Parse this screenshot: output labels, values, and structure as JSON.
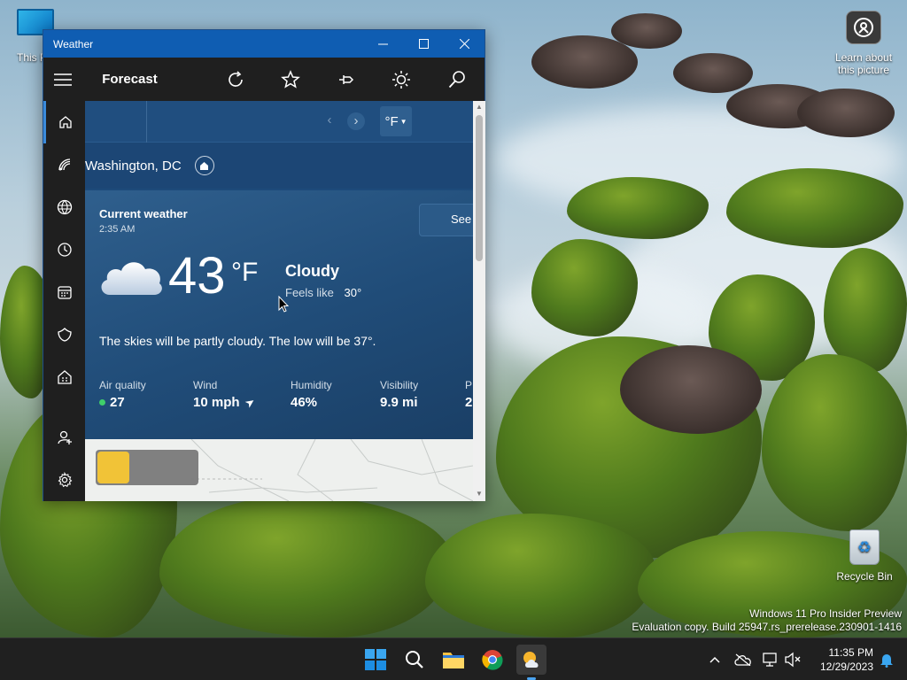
{
  "desktop": {
    "this_pc_label": "This PC",
    "learn_label": "Learn about this picture",
    "recycle_label": "Recycle Bin",
    "watermark_line1": "Windows 11 Pro Insider Preview",
    "watermark_line2": "Evaluation copy. Build 25947.rs_prerelease.230901-1416"
  },
  "window": {
    "title": "Weather",
    "app_title": "Forecast"
  },
  "weather": {
    "unit": "°F",
    "location": "Washington, DC",
    "current_label": "Current weather",
    "time": "2:35 AM",
    "see_btn": "See",
    "temperature": "43",
    "temp_unit": "°F",
    "condition": "Cloudy",
    "feels_label": "Feels like",
    "feels_value": "30°",
    "summary": "The skies will be partly cloudy. The low will be 37°.",
    "stats": [
      {
        "label": "Air quality",
        "value": "27"
      },
      {
        "label": "Wind",
        "value": "10 mph"
      },
      {
        "label": "Humidity",
        "value": "46%"
      },
      {
        "label": "Visibility",
        "value": "9.9 mi"
      },
      {
        "label": "P",
        "value": "2"
      }
    ]
  },
  "taskbar": {
    "time": "11:35 PM",
    "date": "12/29/2023"
  },
  "colors": {
    "titlebar": "#0f5db2",
    "accent": "#3b8bdb",
    "card": "#204c78"
  }
}
